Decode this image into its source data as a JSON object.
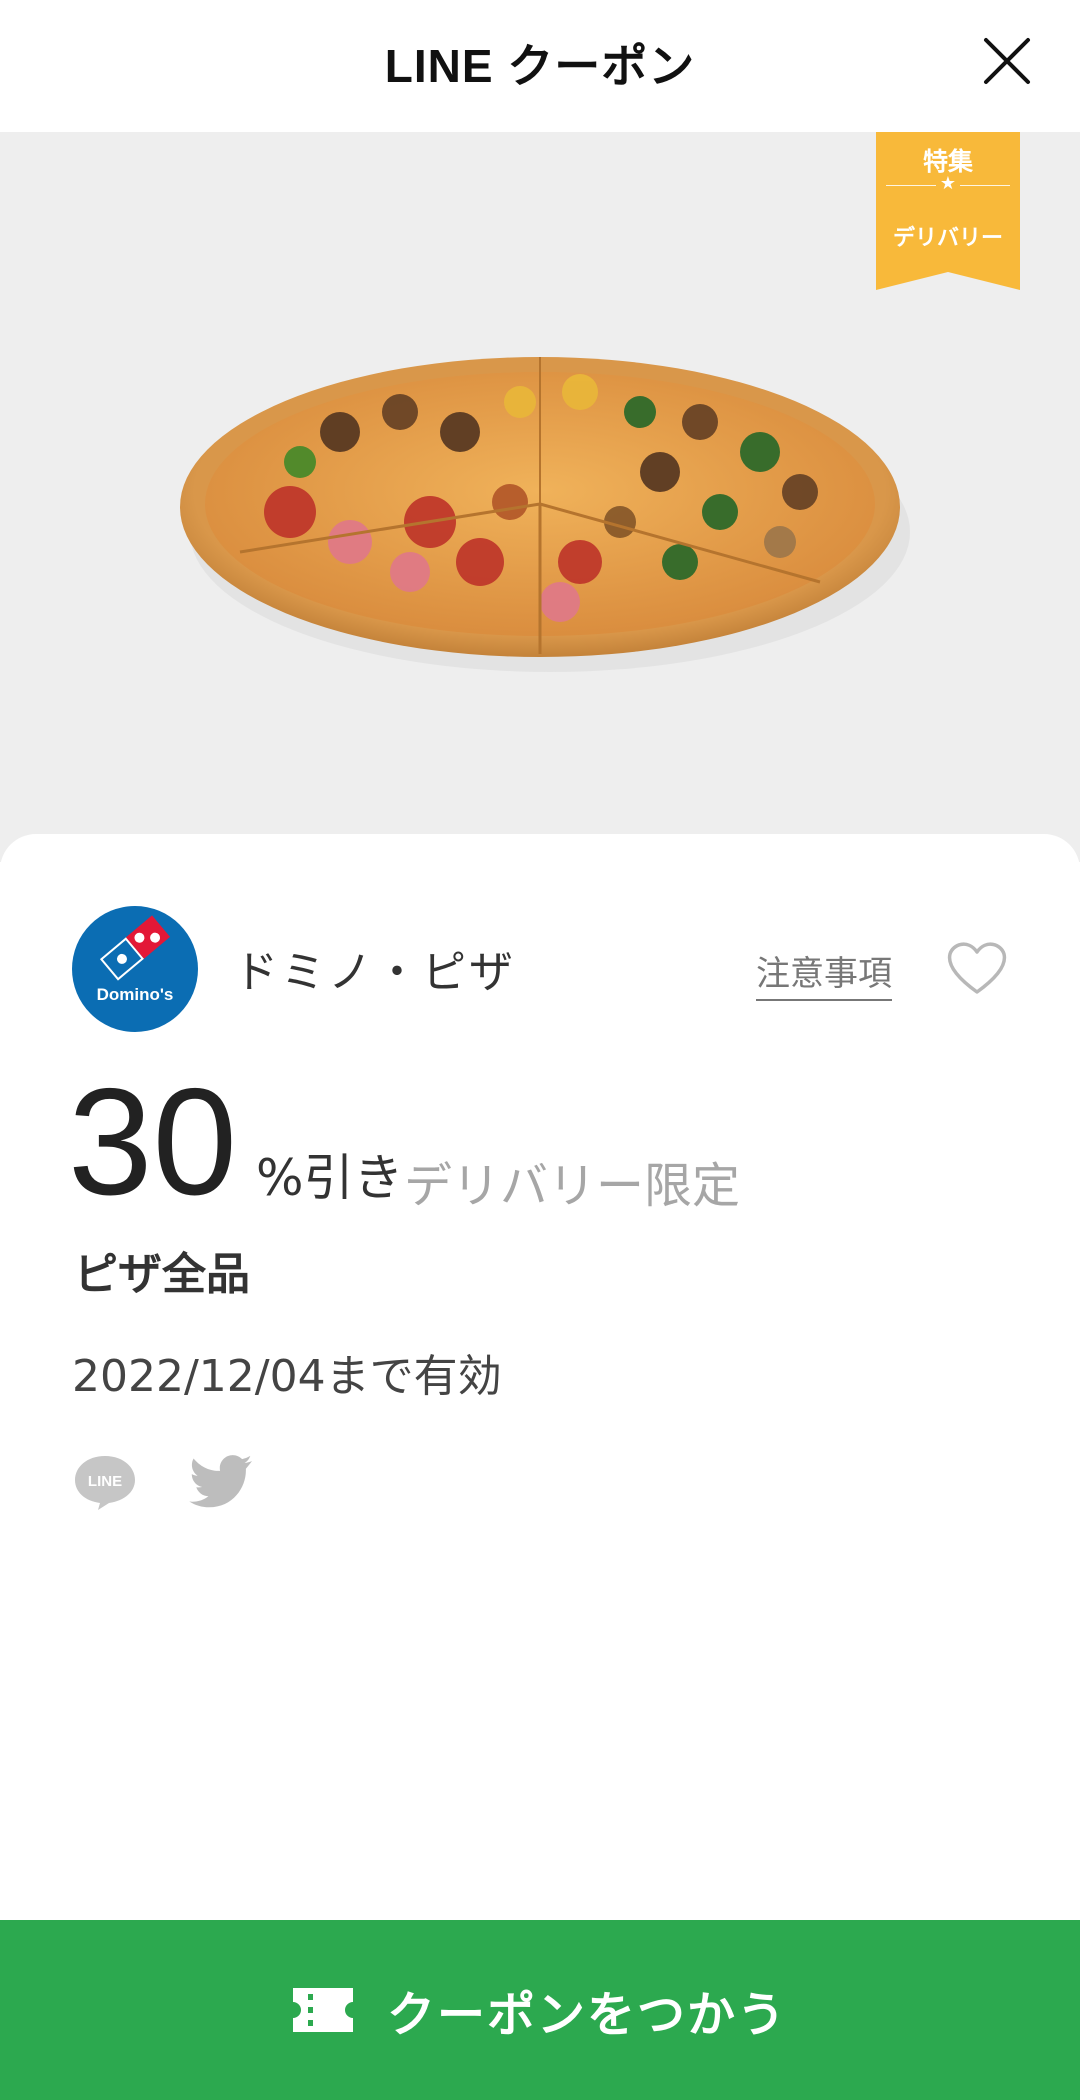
{
  "header": {
    "title": "LINE クーポン",
    "close_icon": "close-icon"
  },
  "hero": {
    "image": "pizza-photo",
    "badge": {
      "top_label": "特集",
      "bottom_label": "デリバリー",
      "color": "#f8b93a"
    }
  },
  "coupon": {
    "brand_name": "ドミノ・ピザ",
    "brand_logo_text": "Domino's",
    "notice_label": "注意事項",
    "favorite_icon": "heart-icon",
    "discount_value": "30",
    "discount_unit": "%引き",
    "limit_label": "デリバリー限定",
    "target": "ピザ全品",
    "expiry": "2022/12/04まで有効",
    "share_line_label": "LINE",
    "share_icons": [
      "line-share-icon",
      "twitter-icon"
    ]
  },
  "footer": {
    "use_button_label": "クーポンをつかう",
    "ticket_icon": "ticket-icon",
    "color": "#2ca94f"
  },
  "colors": {
    "accent_green": "#2ca94f",
    "badge_yellow": "#f8b93a",
    "hero_bg": "#eeeeee",
    "domino_blue": "#0b6db3",
    "domino_red": "#e31837"
  }
}
